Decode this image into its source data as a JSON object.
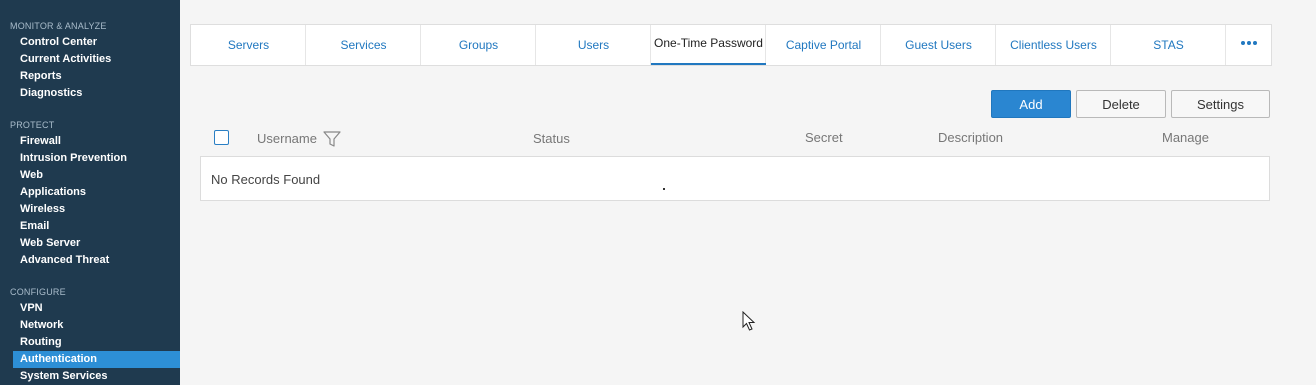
{
  "sidebar": {
    "monitor_title": "MONITOR & ANALYZE",
    "monitor_items": [
      "Control Center",
      "Current Activities",
      "Reports",
      "Diagnostics"
    ],
    "protect_title": "PROTECT",
    "protect_items": [
      "Firewall",
      "Intrusion Prevention",
      "Web",
      "Applications",
      "Wireless",
      "Email",
      "Web Server",
      "Advanced Threat"
    ],
    "configure_title": "CONFIGURE",
    "configure_items": [
      "VPN",
      "Network",
      "Routing",
      "Authentication",
      "System Services"
    ]
  },
  "tabs": [
    "Servers",
    "Services",
    "Groups",
    "Users",
    "One-Time Password",
    "Captive Portal",
    "Guest Users",
    "Clientless Users",
    "STAS"
  ],
  "active_tab": "One-Time Password",
  "more_icon": "ellipsis-icon",
  "actions": {
    "add_label": "Add",
    "delete_label": "Delete",
    "settings_label": "Settings"
  },
  "table": {
    "columns": {
      "username": "Username",
      "status": "Status",
      "secret": "Secret",
      "description": "Description",
      "manage": "Manage"
    },
    "empty_message": "No Records Found"
  },
  "colors": {
    "sidebar_bg": "#1f3a4f",
    "accent": "#2a86d1",
    "link": "#2178c0"
  }
}
